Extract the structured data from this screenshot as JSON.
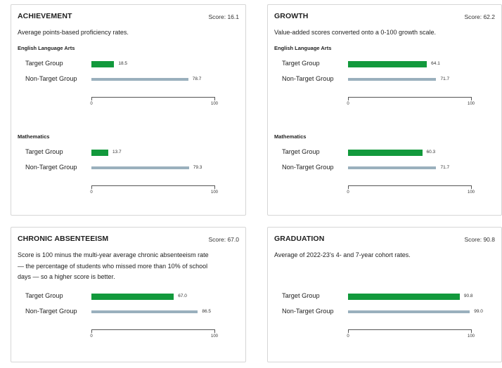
{
  "colors": {
    "target": "#12993c",
    "non_target": "#9ab0bd"
  },
  "cards": [
    {
      "title": "ACHIEVEMENT",
      "score": "Score: 16.1",
      "description": [
        "Average points-based proficiency rates."
      ],
      "sections": [
        {
          "title": "English Language Arts",
          "rows": [
            {
              "label": "Target Group",
              "value": 18.5,
              "value_label": "18.5"
            },
            {
              "label": "Non-Target Group",
              "value": 78.7,
              "value_label": "78.7"
            }
          ]
        },
        {
          "title": "Mathematics",
          "rows": [
            {
              "label": "Target Group",
              "value": 13.7,
              "value_label": "13.7"
            },
            {
              "label": "Non-Target Group",
              "value": 79.3,
              "value_label": "79.3"
            }
          ]
        }
      ]
    },
    {
      "title": "GROWTH",
      "score": "Score: 62.2",
      "description": [
        "Value-added scores converted onto a 0-100 growth scale."
      ],
      "sections": [
        {
          "title": "English Language Arts",
          "rows": [
            {
              "label": "Target Group",
              "value": 64.1,
              "value_label": "64.1"
            },
            {
              "label": "Non-Target Group",
              "value": 71.7,
              "value_label": "71.7"
            }
          ]
        },
        {
          "title": "Mathematics",
          "rows": [
            {
              "label": "Target Group",
              "value": 60.3,
              "value_label": "60.3"
            },
            {
              "label": "Non-Target Group",
              "value": 71.7,
              "value_label": "71.7"
            }
          ]
        }
      ]
    },
    {
      "title": "CHRONIC ABSENTEEISM",
      "score": "Score: 67.0",
      "description": [
        "Score is 100 minus the multi-year average chronic absenteeism rate",
        "— the percentage of students who missed more than 10% of school",
        "days — so a higher score is better."
      ],
      "sections": [
        {
          "title": "",
          "rows": [
            {
              "label": "Target Group",
              "value": 67.0,
              "value_label": "67.0"
            },
            {
              "label": "Non-Target Group",
              "value": 86.5,
              "value_label": "86.5"
            }
          ]
        }
      ]
    },
    {
      "title": "GRADUATION",
      "score": "Score: 90.8",
      "description": [
        "Average of 2022-23’s 4- and 7-year cohort rates."
      ],
      "sections": [
        {
          "title": "",
          "rows": [
            {
              "label": "Target Group",
              "value": 90.8,
              "value_label": "90.8"
            },
            {
              "label": "Non-Target Group",
              "value": 99.0,
              "value_label": "99.0"
            }
          ]
        }
      ]
    }
  ],
  "chart_data": [
    {
      "type": "bar",
      "title": "ACHIEVEMENT — English Language Arts",
      "categories": [
        "Target Group",
        "Non-Target Group"
      ],
      "values": [
        18.5,
        78.7
      ],
      "xlim": [
        0,
        100
      ]
    },
    {
      "type": "bar",
      "title": "ACHIEVEMENT — Mathematics",
      "categories": [
        "Target Group",
        "Non-Target Group"
      ],
      "values": [
        13.7,
        79.3
      ],
      "xlim": [
        0,
        100
      ]
    },
    {
      "type": "bar",
      "title": "GROWTH — English Language Arts",
      "categories": [
        "Target Group",
        "Non-Target Group"
      ],
      "values": [
        64.1,
        71.7
      ],
      "xlim": [
        0,
        100
      ]
    },
    {
      "type": "bar",
      "title": "GROWTH — Mathematics",
      "categories": [
        "Target Group",
        "Non-Target Group"
      ],
      "values": [
        60.3,
        71.7
      ],
      "xlim": [
        0,
        100
      ]
    },
    {
      "type": "bar",
      "title": "CHRONIC ABSENTEEISM",
      "categories": [
        "Target Group",
        "Non-Target Group"
      ],
      "values": [
        67.0,
        86.5
      ],
      "xlim": [
        0,
        100
      ]
    },
    {
      "type": "bar",
      "title": "GRADUATION",
      "categories": [
        "Target Group",
        "Non-Target Group"
      ],
      "values": [
        90.8,
        99.0
      ],
      "xlim": [
        0,
        100
      ]
    }
  ],
  "axis": {
    "min_label": "0",
    "max_label": "100"
  }
}
